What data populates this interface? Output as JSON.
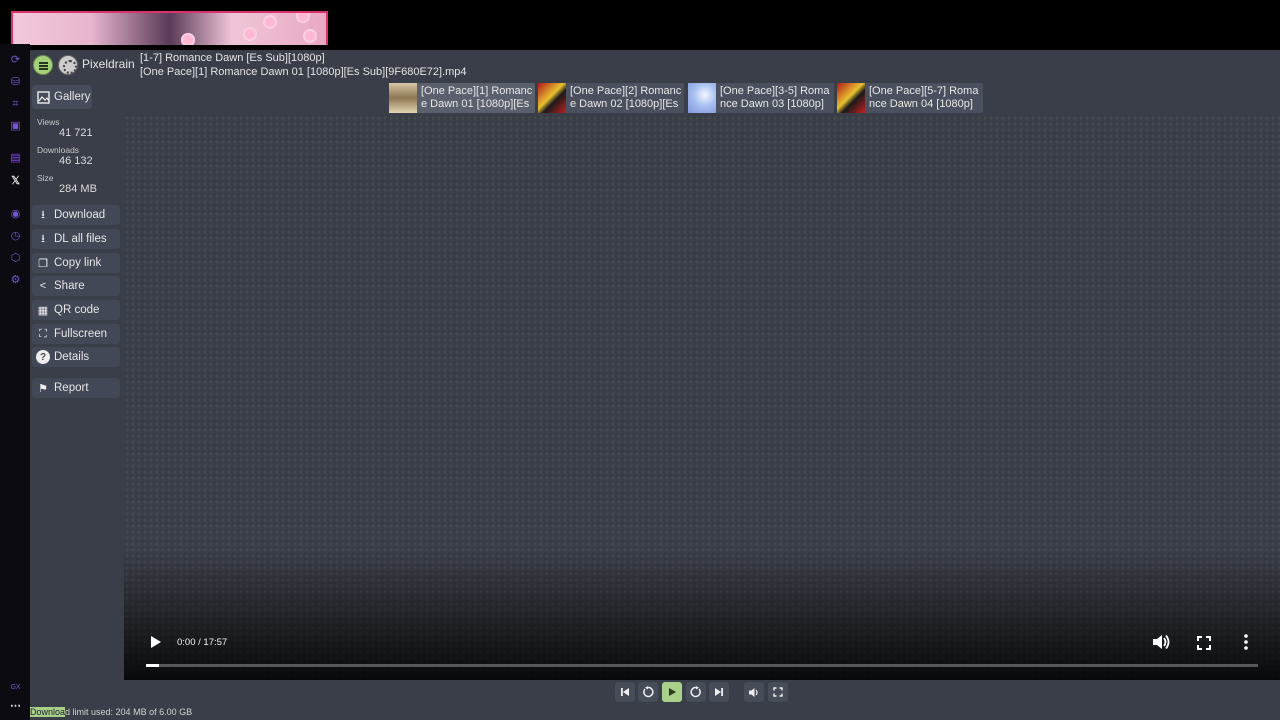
{
  "header": {
    "brand": "Pixeldrain",
    "list_title": "[1-7] Romance Dawn [Es Sub][1080p]",
    "file_name": "[One Pace][1] Romance Dawn 01 [1080p][Es Sub][9F680E72].mp4"
  },
  "sidebar": {
    "gallery_label": "Gallery",
    "stats": [
      {
        "label": "Views",
        "value": "41 721"
      },
      {
        "label": "Downloads",
        "value": "46 132"
      },
      {
        "label": "Size",
        "value": "284 MB"
      }
    ],
    "actions": [
      {
        "label": "Download",
        "icon": "download-icon"
      },
      {
        "label": "DL all files",
        "icon": "download-icon"
      },
      {
        "label": "Copy link",
        "icon": "copy-icon"
      },
      {
        "label": "Share",
        "icon": "share-icon"
      },
      {
        "label": "QR code",
        "icon": "qr-code-icon"
      },
      {
        "label": "Fullscreen",
        "icon": "fullscreen-icon"
      },
      {
        "label": "Details",
        "icon": "help-icon"
      },
      {
        "label": "Report",
        "icon": "flag-icon"
      }
    ]
  },
  "playlist": [
    {
      "label": "[One Pace][1] Romance Dawn 01 [1080p][Es",
      "active": true
    },
    {
      "label": "[One Pace][2] Romance Dawn 02 [1080p][Es",
      "active": false
    },
    {
      "label": "[One Pace][3-5] Romance Dawn 03 [1080p]",
      "active": false
    },
    {
      "label": "[One Pace][5-7] Romance Dawn 04 [1080p]",
      "active": false
    }
  ],
  "player": {
    "time": "0:00 / 17:57",
    "progress_fraction": 0.012
  },
  "status": {
    "highlight": "Downloa",
    "text": "d limit used: 204 MB of 6.00 GB"
  },
  "colors": {
    "accent": "#a8d08a",
    "app_bg": "#393e48",
    "banner_border": "#d9326d"
  }
}
